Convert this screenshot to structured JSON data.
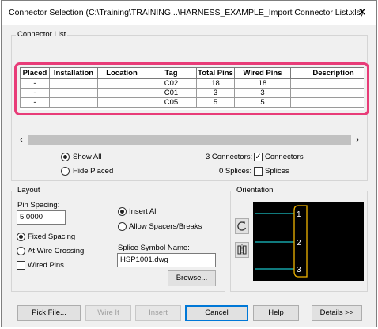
{
  "window": {
    "title": "Connector Selection  (C:\\Training\\TRAINING...\\HARNESS_EXAMPLE_Import Connector List.xls)",
    "close_glyph": "✕"
  },
  "connector_list": {
    "label": "Connector List",
    "columns": [
      "Placed",
      "Installation",
      "Location",
      "Tag",
      "Total Pins",
      "Wired Pins",
      "Description"
    ],
    "rows": [
      [
        "-",
        "",
        "",
        "C02",
        "18",
        "18",
        ""
      ],
      [
        "-",
        "",
        "",
        "C01",
        "3",
        "3",
        ""
      ],
      [
        "-",
        "",
        "",
        "C05",
        "5",
        "5",
        ""
      ]
    ],
    "scroll_left": "‹",
    "scroll_right": "›",
    "show_all_label": "Show All",
    "hide_placed_label": "Hide Placed",
    "show_mode": "show_all",
    "connectors_count": "3 Connectors:",
    "connectors_label": "Connectors",
    "connectors_checked": true,
    "splices_count": "0 Splices:",
    "splices_label": "Splices",
    "splices_checked": false
  },
  "layout": {
    "label": "Layout",
    "pin_spacing_label": "Pin Spacing:",
    "pin_spacing_value": "5.0000",
    "fixed_spacing_label": "Fixed Spacing",
    "at_wire_crossing_label": "At Wire Crossing",
    "spacing_mode": "fixed",
    "wired_pins_label": "Wired Pins",
    "wired_pins_checked": false,
    "insert_all_label": "Insert All",
    "allow_spacers_label": "Allow Spacers/Breaks",
    "insert_mode": "insert_all",
    "splice_symbol_label": "Splice Symbol Name:",
    "splice_symbol_value": "HSP1001.dwg",
    "browse_label": "Browse..."
  },
  "orientation": {
    "label": "Orientation",
    "pins": [
      "1",
      "2",
      "3"
    ],
    "colors": {
      "wire": "#19c3c8",
      "connector": "#f0b400",
      "pin_text": "#ffffff"
    }
  },
  "buttons": {
    "pick_file": "Pick File...",
    "wire_it": "Wire It",
    "insert": "Insert",
    "cancel": "Cancel",
    "help": "Help",
    "details": "Details >>"
  },
  "colors": {
    "highlight": "#e83c78",
    "default_button": "#0078d7"
  }
}
